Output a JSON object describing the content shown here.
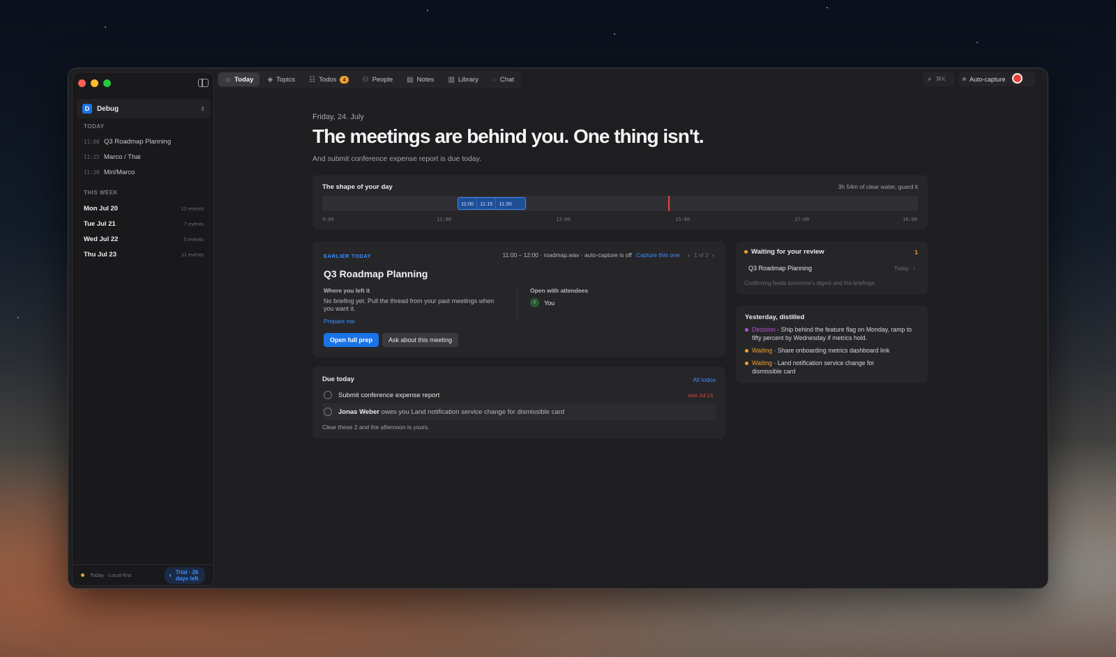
{
  "window_controls": {
    "close_color": "#ff5f57",
    "minimize_color": "#febc2e",
    "zoom_color": "#28c840"
  },
  "sidebar": {
    "workspace": {
      "initial": "D",
      "name": "Debug"
    },
    "today_label": "TODAY",
    "today_items": [
      {
        "time": "11:00",
        "title": "Q3 Roadmap Planning"
      },
      {
        "time": "11:15",
        "title": "Marco / Thai"
      },
      {
        "time": "11:30",
        "title": "Miri/Marco"
      }
    ],
    "week_label": "THIS WEEK",
    "week_items": [
      {
        "day": "Mon Jul 20",
        "count": "12 events"
      },
      {
        "day": "Tue Jul 21",
        "count": "7 events"
      },
      {
        "day": "Wed Jul 22",
        "count": "5 events"
      },
      {
        "day": "Thu Jul 23",
        "count": "11 events"
      }
    ],
    "footer": {
      "status": "Today · Local-first",
      "trial": "Trial · 26 days left"
    }
  },
  "toolbar": {
    "tabs": [
      {
        "label": "Today",
        "icon": "sun-icon"
      },
      {
        "label": "Topics",
        "icon": "layers-icon"
      },
      {
        "label": "Todos",
        "icon": "checklist-icon",
        "badge": "4"
      },
      {
        "label": "People",
        "icon": "people-icon"
      },
      {
        "label": "Notes",
        "icon": "note-icon"
      },
      {
        "label": "Library",
        "icon": "library-icon"
      },
      {
        "label": "Chat",
        "icon": "chat-icon"
      }
    ],
    "search_shortcut": "⌘K",
    "autocapture_label": "Auto-capture"
  },
  "main": {
    "date": "Friday, 24. July",
    "headline": "The meetings are behind you. One thing isn't.",
    "subtitle": "And submit conference expense report is due today.",
    "day_shape": {
      "title": "The shape of your day",
      "summary": "3h 54m of clear water, guard it",
      "block_times": [
        "11:00",
        "11:15",
        "11:30"
      ],
      "ticks": [
        "9:00",
        "11:00",
        "13:00",
        "15:00",
        "17:00",
        "18:00"
      ]
    },
    "earlier": {
      "eyebrow": "EARLIER TODAY",
      "meta": "11:00 – 12:00 · roadmap.wav · auto-capture is off",
      "capture_link": "Capture this one",
      "pager": "1 of 3",
      "title": "Q3 Roadmap Planning",
      "left_heading": "Where you left it",
      "left_text": "No briefing yet. Pull the thread from your past meetings when you want it.",
      "prepare_link": "Prepare me",
      "right_heading": "Open with attendees",
      "attendee_initial": "Y",
      "attendee": "You",
      "primary_button": "Open full prep",
      "secondary_button": "Ask about this meeting"
    },
    "due": {
      "title": "Due today",
      "all_link": "All todos",
      "items": [
        {
          "text": "Submit conference expense report",
          "tag": "was Jul 23"
        },
        {
          "person": "Jonas Weber",
          "text": "owes you Land notification service change for dismissible card"
        }
      ],
      "footer": "Clear these 2 and the afternoon is yours."
    },
    "review": {
      "title": "Waiting for your review",
      "count": "1",
      "item": "Q3 Roadmap Planning",
      "item_when": "Today",
      "note": "Confirming feeds tomorrow's digest and the briefings."
    },
    "yesterday": {
      "title": "Yesterday, distilled",
      "items": [
        {
          "kind": "Decision",
          "text": "· Ship behind the feature flag on Monday, ramp to fifty percent by Wednesday if metrics hold.",
          "color": "#c04ee0"
        },
        {
          "kind": "Waiting",
          "text": "· Share onboarding metrics dashboard link",
          "color": "#f0a030"
        },
        {
          "kind": "Waiting",
          "text": "· Land notification service change for dismissible card",
          "color": "#f0a030"
        }
      ]
    }
  },
  "colors": {
    "accent": "#1a73e8",
    "link": "#3d8eff",
    "warning": "#f0a030",
    "danger": "#e6423a"
  }
}
